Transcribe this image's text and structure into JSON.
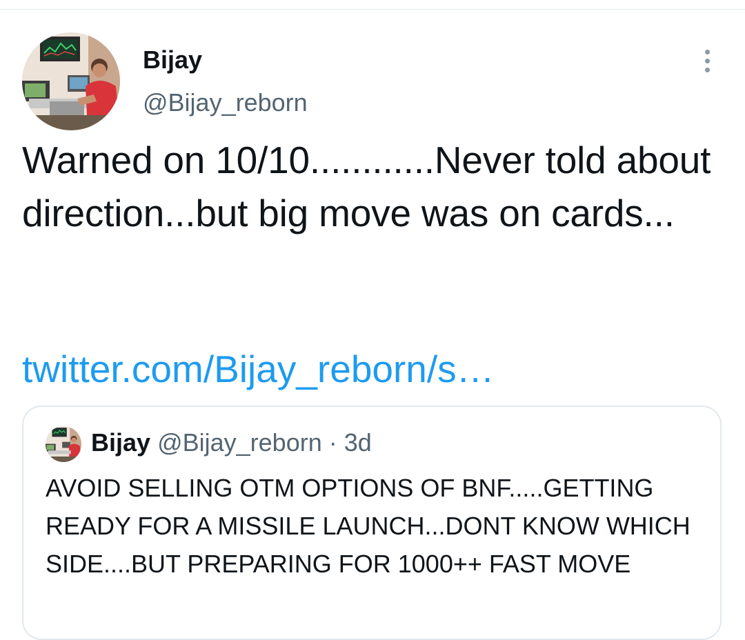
{
  "author": {
    "display_name": "Bijay",
    "handle": "@Bijay_reborn"
  },
  "tweet": {
    "text": "Warned on 10/10............Never told about direction...but big move was on cards...",
    "link_text": "twitter.com/Bijay_reborn/s…"
  },
  "quoted_tweet": {
    "display_name": "Bijay",
    "handle": "@Bijay_reborn",
    "separator": "·",
    "time": "3d",
    "text": "AVOID SELLING OTM OPTIONS OF BNF.....GETTING READY FOR A MISSILE LAUNCH...DONT KNOW WHICH SIDE....BUT PREPARING FOR 1000++ FAST MOVE"
  },
  "icons": {
    "more": "more-vertical-icon"
  },
  "colors": {
    "text_primary": "#0f1419",
    "text_secondary": "#536471",
    "link": "#1d9bf0",
    "border": "#e1e8ed"
  }
}
